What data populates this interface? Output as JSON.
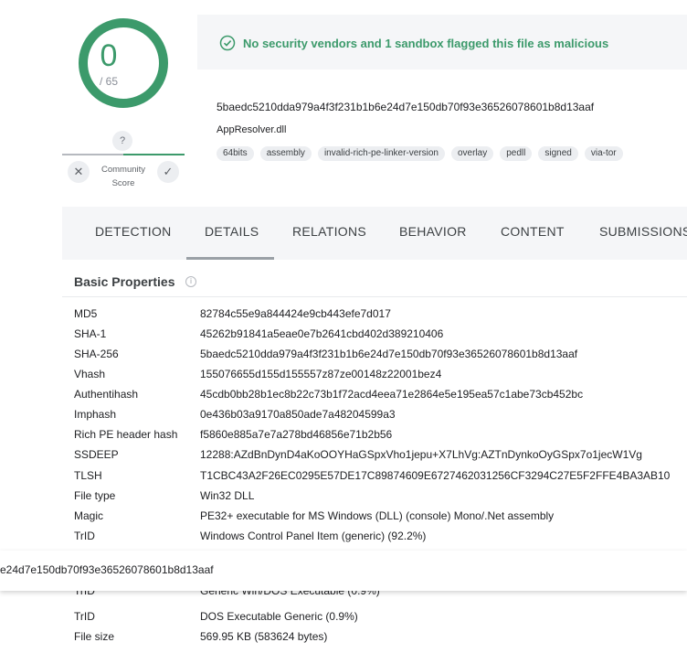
{
  "score": {
    "detections": "0",
    "total": "/ 65",
    "unknown_vote": "?",
    "community_label": "Community Score",
    "vote_down_glyph": "✕",
    "vote_up_glyph": "✓",
    "color_ok": "#3c9a6b"
  },
  "summary": {
    "message": "No security vendors and 1 sandbox flagged this file as malicious",
    "icon": "check-circle-icon"
  },
  "file": {
    "sha256": "5baedc5210dda979a4f3f231b1b6e24d7e150db70f93e36526078601b8d13aaf",
    "name": "AppResolver.dll",
    "tags": [
      "64bits",
      "assembly",
      "invalid-rich-pe-linker-version",
      "overlay",
      "pedll",
      "signed",
      "via-tor"
    ]
  },
  "tabs": [
    "DETECTION",
    "DETAILS",
    "RELATIONS",
    "BEHAVIOR",
    "CONTENT",
    "SUBMISSIONS"
  ],
  "active_tab": "DETAILS",
  "basic_properties": {
    "title": "Basic Properties",
    "info_glyph": "i",
    "rows": [
      {
        "key": "MD5",
        "value": "82784c55e9a844424e9cb443efe7d017"
      },
      {
        "key": "SHA-1",
        "value": "45262b91841a5eae0e7b2641cbd402d389210406"
      },
      {
        "key": "SHA-256",
        "value": "5baedc5210dda979a4f3f231b1b6e24d7e150db70f93e36526078601b8d13aaf"
      },
      {
        "key": "Vhash",
        "value": "155076655d155d155557z87ze00148z22001bez4"
      },
      {
        "key": "Authentihash",
        "value": "45cdb0bb28b1ec8b22c73b1f72acd4eea71e2864e5e195ea57c1abe73cb452bc"
      },
      {
        "key": "Imphash",
        "value": "0e436b03a9170a850ade7a48204599a3"
      },
      {
        "key": "Rich PE header hash",
        "value": "f5860e885a7e7a278bd46856e71b2b56"
      },
      {
        "key": "SSDEEP",
        "value": "12288:AZdBnDynD4aKoOOYHaGSpxVho1jepu+X7LhVg:AZTnDynkoOyGSpx7o1jecW1Vg"
      },
      {
        "key": "TLSH",
        "value": "T1CBC43A2F26EC0295E57DE17C89874609E6727462031256CF3294C27E5F2FFE4BA3AB10"
      },
      {
        "key": "File type",
        "value": "Win32 DLL"
      },
      {
        "key": "Magic",
        "value": "PE32+ executable for MS Windows (DLL) (console) Mono/.Net assembly"
      },
      {
        "key": "TrID",
        "value": "Windows Control Panel Item (generic) (92.2%)"
      }
    ],
    "partial_row": {
      "key": "TrID",
      "value": "Generic Win/DOS Executable (0.9%)"
    },
    "rows_after": [
      {
        "key": "TrID",
        "value": "DOS Executable Generic (0.9%)"
      },
      {
        "key": "File size",
        "value": "569.95 KB (583624 bytes)"
      }
    ]
  },
  "tooltip": {
    "text": "e24d7e150db70f93e36526078601b8d13aaf"
  }
}
